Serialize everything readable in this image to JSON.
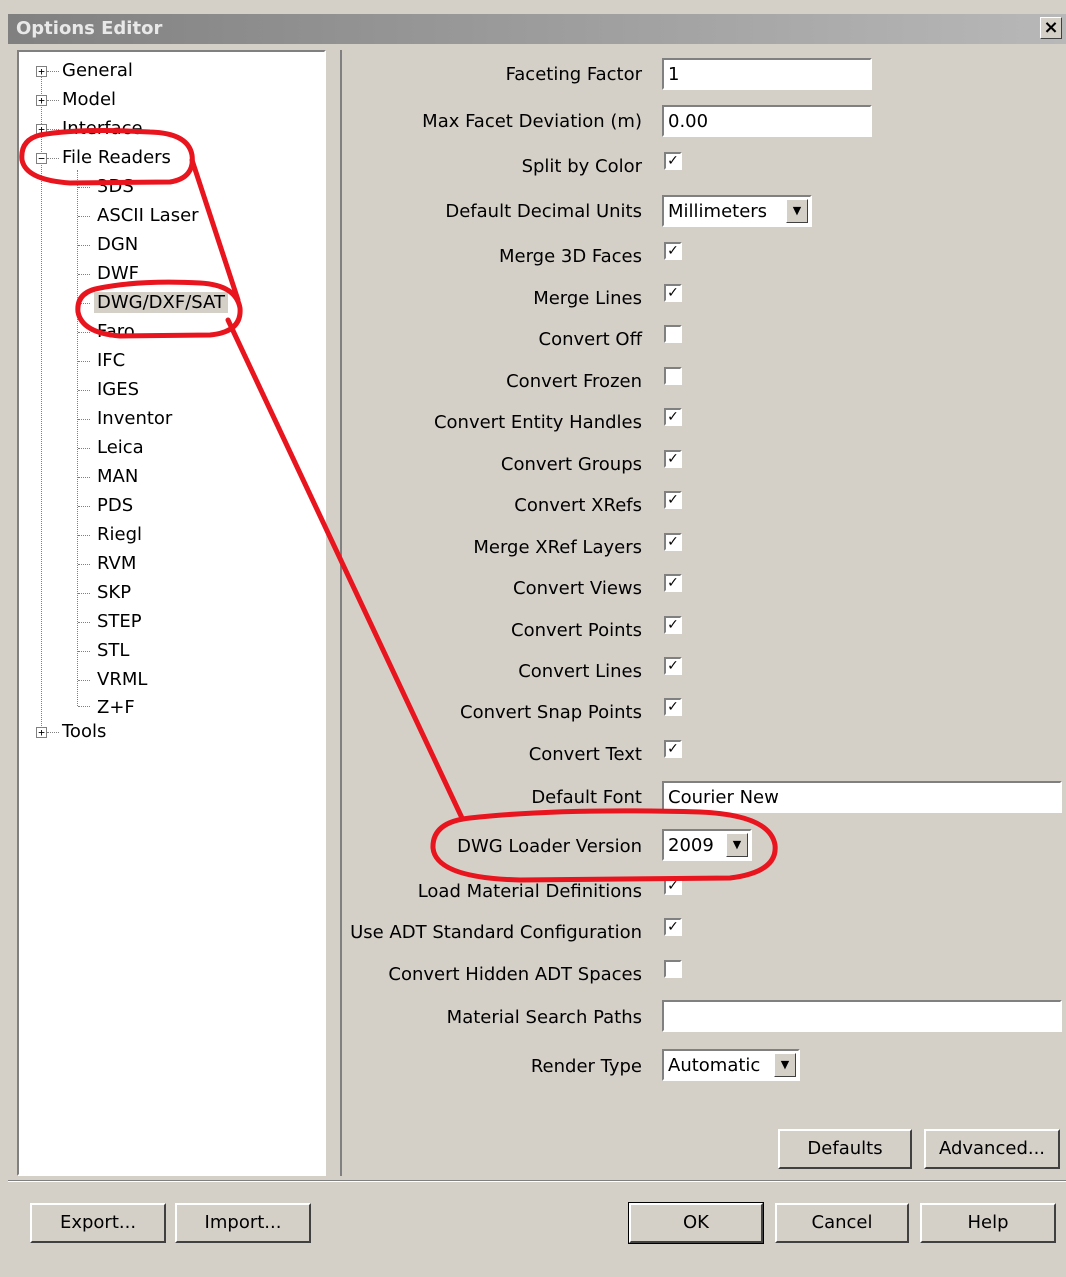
{
  "window": {
    "title": "Options Editor",
    "close_glyph": "×"
  },
  "tree": {
    "items": [
      {
        "label": "General",
        "expander": "+"
      },
      {
        "label": "Model",
        "expander": "+"
      },
      {
        "label": "Interface",
        "expander": "+"
      },
      {
        "label": "File Readers",
        "expander": "−"
      },
      {
        "label": "3DS"
      },
      {
        "label": "ASCII Laser"
      },
      {
        "label": "DGN"
      },
      {
        "label": "DWF"
      },
      {
        "label": "DWG/DXF/SAT",
        "selected": true
      },
      {
        "label": "Faro"
      },
      {
        "label": "IFC"
      },
      {
        "label": "IGES"
      },
      {
        "label": "Inventor"
      },
      {
        "label": "Leica"
      },
      {
        "label": "MAN"
      },
      {
        "label": "PDS"
      },
      {
        "label": "Riegl"
      },
      {
        "label": "RVM"
      },
      {
        "label": "SKP"
      },
      {
        "label": "STEP"
      },
      {
        "label": "STL"
      },
      {
        "label": "VRML"
      },
      {
        "label": "Z+F"
      },
      {
        "label": "Tools",
        "expander": "+"
      }
    ]
  },
  "settings": {
    "faceting_factor": {
      "label": "Faceting Factor",
      "value": "1"
    },
    "max_facet_deviation": {
      "label": "Max Facet Deviation (m)",
      "value": "0.00"
    },
    "split_by_color": {
      "label": "Split by Color",
      "checked": true
    },
    "default_decimal_units": {
      "label": "Default Decimal Units",
      "value": "Millimeters"
    },
    "merge_3d_faces": {
      "label": "Merge 3D Faces",
      "checked": true
    },
    "merge_lines": {
      "label": "Merge Lines",
      "checked": true
    },
    "convert_off": {
      "label": "Convert Off",
      "checked": false
    },
    "convert_frozen": {
      "label": "Convert Frozen",
      "checked": false
    },
    "convert_entity_handles": {
      "label": "Convert Entity Handles",
      "checked": true
    },
    "convert_groups": {
      "label": "Convert Groups",
      "checked": true
    },
    "convert_xrefs": {
      "label": "Convert XRefs",
      "checked": true
    },
    "merge_xref_layers": {
      "label": "Merge XRef Layers",
      "checked": true
    },
    "convert_views": {
      "label": "Convert Views",
      "checked": true
    },
    "convert_points": {
      "label": "Convert Points",
      "checked": true
    },
    "convert_lines": {
      "label": "Convert Lines",
      "checked": true
    },
    "convert_snap_points": {
      "label": "Convert Snap Points",
      "checked": true
    },
    "convert_text": {
      "label": "Convert Text",
      "checked": true
    },
    "default_font": {
      "label": "Default Font",
      "value": "Courier New"
    },
    "dwg_loader_version": {
      "label": "DWG Loader Version",
      "value": "2009"
    },
    "load_material_definitions": {
      "label": "Load Material Definitions",
      "checked": true
    },
    "use_adt_standard_config": {
      "label": "Use ADT Standard Configuration",
      "checked": true
    },
    "convert_hidden_adt_spaces": {
      "label": "Convert Hidden ADT Spaces",
      "checked": false
    },
    "material_search_paths": {
      "label": "Material Search Paths",
      "value": ""
    },
    "render_type": {
      "label": "Render Type",
      "value": "Automatic"
    }
  },
  "check_glyph": "✓",
  "dropdown_glyph": "▼",
  "panel_buttons": {
    "defaults": "Defaults",
    "advanced": "Advanced..."
  },
  "footer_buttons": {
    "export": "Export...",
    "import": "Import...",
    "ok": "OK",
    "cancel": "Cancel",
    "help": "Help"
  },
  "colors": {
    "annotation_red": "#e8141e",
    "dialog_gray": "#d4d0c8"
  }
}
